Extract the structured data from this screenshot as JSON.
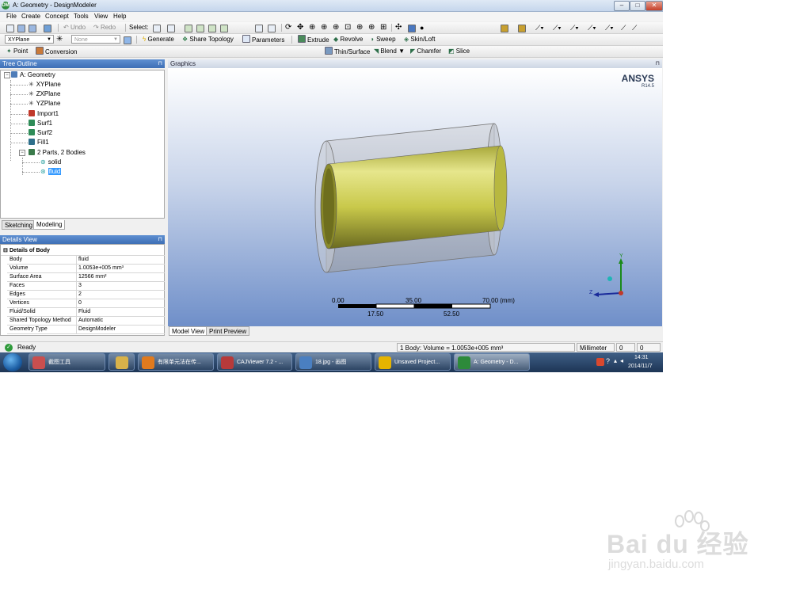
{
  "window": {
    "title": "A: Geometry - DesignModeler",
    "app_icon": "DM",
    "controls": [
      "–",
      "□",
      "✕"
    ]
  },
  "menu": [
    "File",
    "Create",
    "Concept",
    "Tools",
    "View",
    "Help"
  ],
  "toolbar1": {
    "undo": "Undo",
    "redo": "Redo",
    "select": "Select:"
  },
  "toolbar2": {
    "plane": "XYPlane",
    "sketch": "None",
    "generate": "Generate",
    "share_topology": "Share Topology",
    "parameters": "Parameters",
    "extrude": "Extrude",
    "revolve": "Revolve",
    "sweep": "Sweep",
    "skin_loft": "Skin/Loft"
  },
  "toolbar3": {
    "point": "Point",
    "conversion": "Conversion",
    "thin_surface": "Thin/Surface",
    "blend": "Blend",
    "chamfer": "Chamfer",
    "slice": "Slice"
  },
  "tree_outline": {
    "header": "Tree Outline",
    "nodes": [
      {
        "label": "A: Geometry",
        "icon": "geometry-icon",
        "color": "#4f7db8"
      },
      {
        "label": "XYPlane",
        "icon": "plane-icon",
        "color": "#333333"
      },
      {
        "label": "ZXPlane",
        "icon": "plane-icon",
        "color": "#333333"
      },
      {
        "label": "YZPlane",
        "icon": "plane-icon",
        "color": "#333333"
      },
      {
        "label": "Import1",
        "icon": "import-icon",
        "color": "#c0392b"
      },
      {
        "label": "Surf1",
        "icon": "surface-icon",
        "color": "#2e8b57"
      },
      {
        "label": "Surf2",
        "icon": "surface-icon",
        "color": "#2e8b57"
      },
      {
        "label": "Fill1",
        "icon": "fill-icon",
        "color": "#2e6f8b"
      },
      {
        "label": "2 Parts, 2 Bodies",
        "icon": "parts-icon",
        "color": "#3a7a4a"
      },
      {
        "label": "solid",
        "icon": "body-icon",
        "color": "#2aa0a0"
      },
      {
        "label": "fluid",
        "icon": "body-icon",
        "color": "#2aa0a0"
      }
    ],
    "selected": "fluid"
  },
  "panel_tabs": [
    "Sketching",
    "Modeling"
  ],
  "details_view": {
    "header": "Details View",
    "group": "Details of Body",
    "rows": [
      {
        "key": "Body",
        "value": "fluid"
      },
      {
        "key": "Volume",
        "value": "1.0053e+005 mm³"
      },
      {
        "key": "Surface Area",
        "value": "12566 mm²"
      },
      {
        "key": "Faces",
        "value": "3"
      },
      {
        "key": "Edges",
        "value": "2"
      },
      {
        "key": "Vertices",
        "value": "0"
      },
      {
        "key": "Fluid/Solid",
        "value": "Fluid"
      },
      {
        "key": "Shared Topology Method",
        "value": "Automatic"
      },
      {
        "key": "Geometry Type",
        "value": "DesignModeler"
      }
    ]
  },
  "graphics": {
    "header": "Graphics",
    "brand": "ANSYS",
    "version": "R14.5",
    "scale_top": [
      "0.00",
      "35.00",
      "70.00 (mm)"
    ],
    "scale_bottom": [
      "17.50",
      "52.50"
    ],
    "axes": {
      "y": "Y",
      "z": "Z"
    },
    "colors": {
      "inner_cylinder": "#c8c84a",
      "outer_cylinder": "#b8bcc6"
    }
  },
  "view_tabs": [
    "Model View",
    "Print Preview"
  ],
  "status": {
    "state": "Ready",
    "selection": "1 Body: Volume = 1.0053e+005 mm³",
    "units": "Millimeter",
    "x": "0",
    "y": "0"
  },
  "taskbar": {
    "items": [
      {
        "label": "截图工具",
        "color": "#c94f4f"
      },
      {
        "label": "",
        "color": "#d8b24a"
      },
      {
        "label": "有限单元法在传...",
        "color": "#e07a1e"
      },
      {
        "label": "CAJViewer 7.2 - ...",
        "color": "#b73a3a"
      },
      {
        "label": "18.jpg - 画图",
        "color": "#4a7fc1"
      },
      {
        "label": "Unsaved Project...",
        "color": "#e6b400"
      },
      {
        "label": "A: Geometry - D...",
        "color": "#2d8a3a"
      }
    ],
    "time": "14:31",
    "date": "2014/11/7"
  },
  "watermark": {
    "brand": "Bai du 经验",
    "url": "jingyan.baidu.com"
  }
}
